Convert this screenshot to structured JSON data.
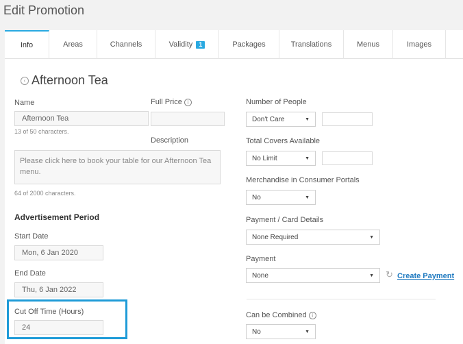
{
  "page_title": "Edit Promotion",
  "tabs": [
    {
      "label": "Info"
    },
    {
      "label": "Areas"
    },
    {
      "label": "Channels"
    },
    {
      "label": "Validity",
      "badge": "1"
    },
    {
      "label": "Packages"
    },
    {
      "label": "Translations"
    },
    {
      "label": "Menus"
    },
    {
      "label": "Images"
    }
  ],
  "promo_title": "Afternoon Tea",
  "left": {
    "name_label": "Name",
    "name_value": "Afternoon Tea",
    "name_hint": "13 of 50 characters.",
    "full_price_label": "Full Price",
    "full_price_value": "",
    "description_label": "Description",
    "description_value": "Please click here to book your table for our Afternoon Tea menu.",
    "description_hint": "64 of 2000 characters.",
    "ad_period_heading": "Advertisement Period",
    "start_date_label": "Start Date",
    "start_date_value": "Mon, 6 Jan 2020",
    "end_date_label": "End Date",
    "end_date_value": "Thu, 6 Jan 2022",
    "cutoff_label": "Cut Off Time (Hours)",
    "cutoff_value": "24"
  },
  "right": {
    "people_label": "Number of People",
    "people_value": "Don't Care",
    "covers_label": "Total Covers Available",
    "covers_value": "No Limit",
    "merch_label": "Merchandise in Consumer Portals",
    "merch_value": "No",
    "card_label": "Payment / Card Details",
    "card_value": "None Required",
    "payment_label": "Payment",
    "payment_value": "None",
    "create_payment_label": "Create Payment",
    "combined_label": "Can be Combined",
    "combined_value": "No"
  },
  "colors": {
    "accent": "#29a9e1",
    "highlight": "#1e9bd7",
    "link": "#1f7ac0"
  }
}
